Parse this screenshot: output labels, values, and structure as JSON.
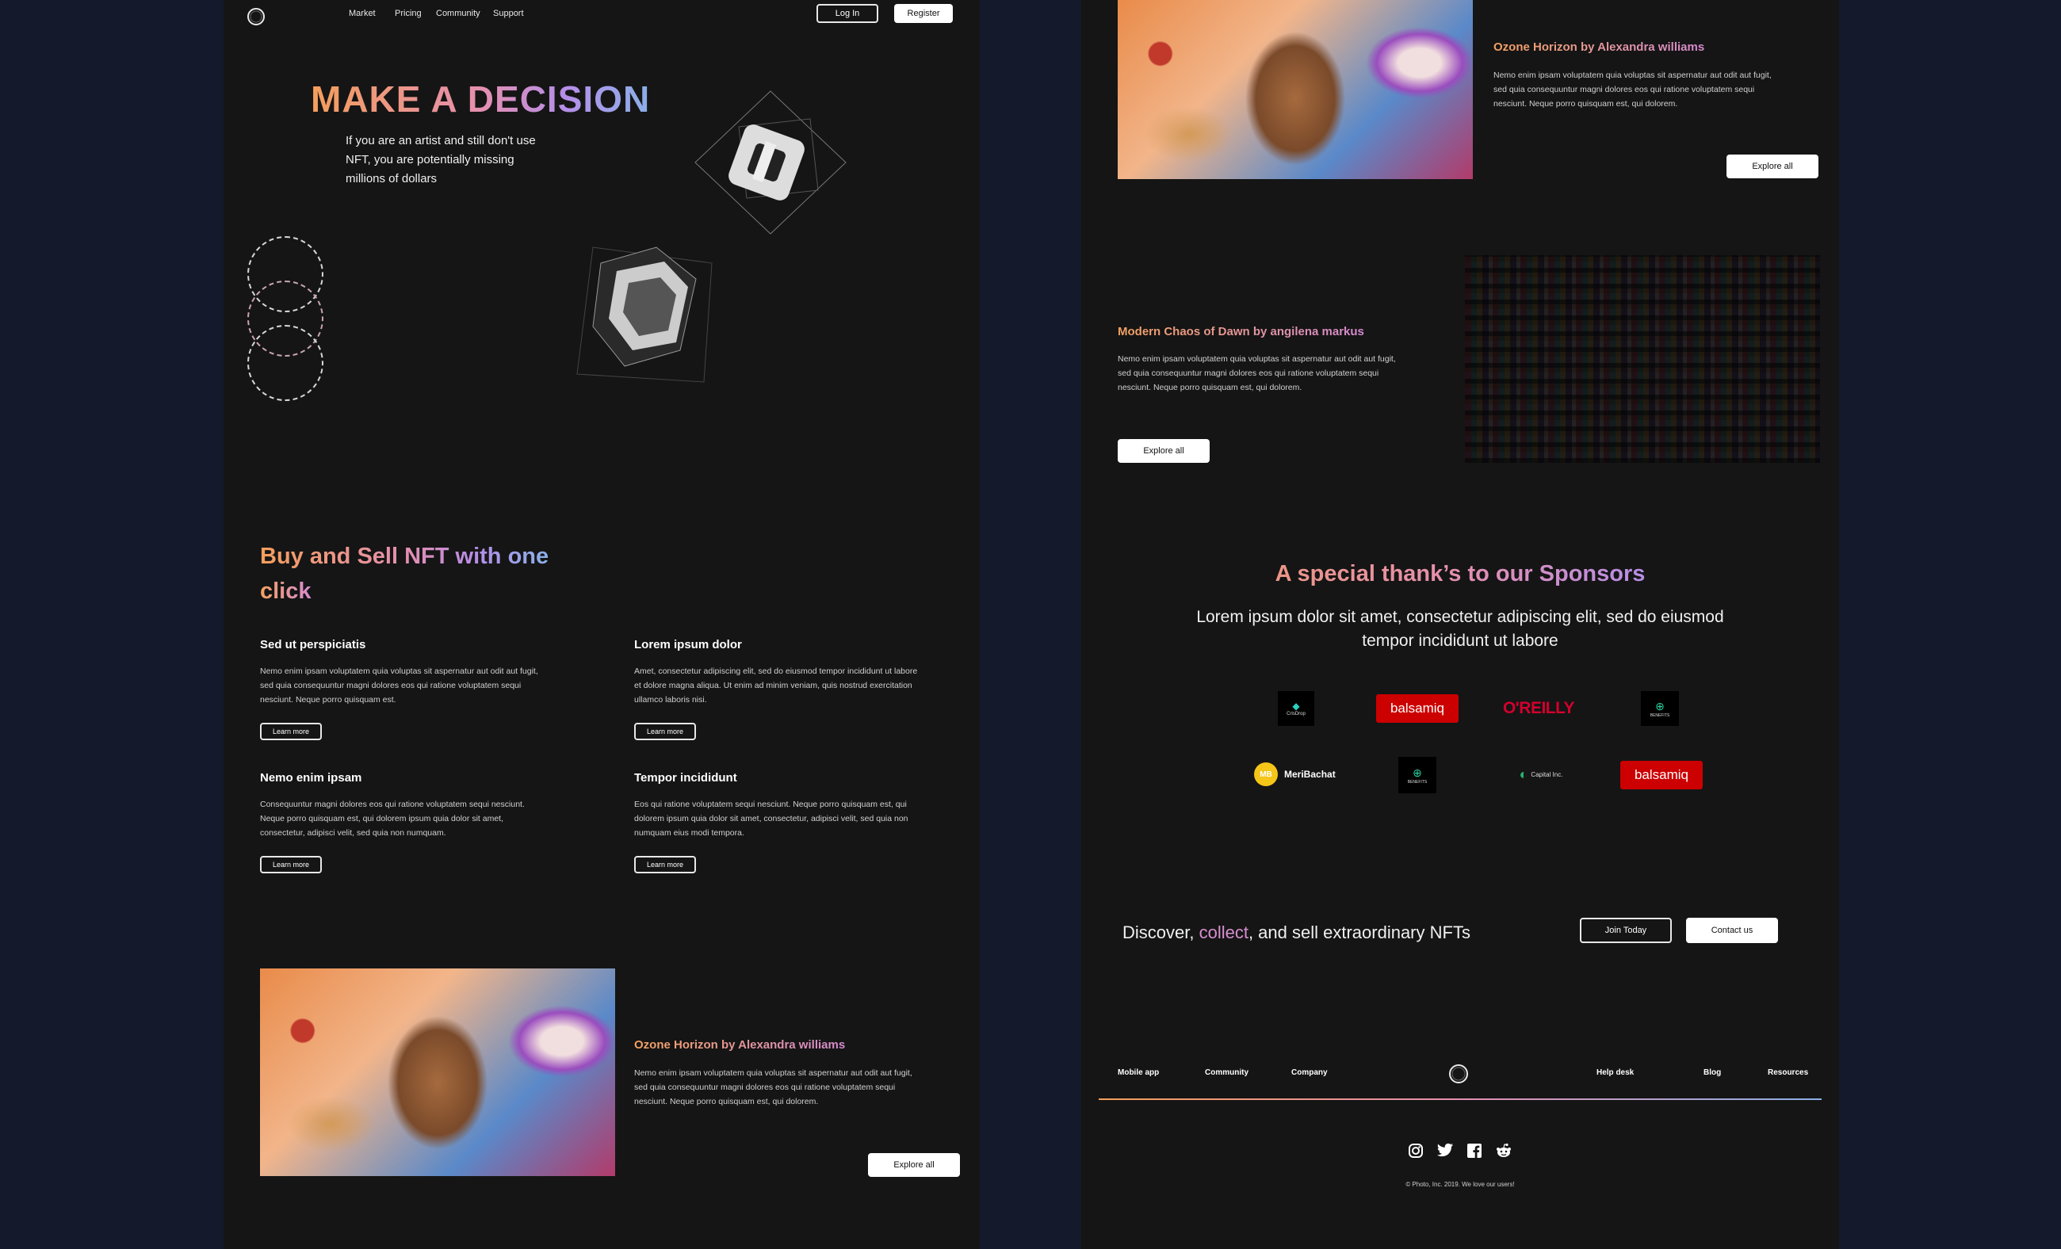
{
  "nav": {
    "links": [
      "Market",
      "Pricing",
      "Community",
      "Support"
    ],
    "login_label": "Log In",
    "register_label": "Register"
  },
  "hero": {
    "title": "MAKE A DECISION",
    "subtitle_lines": [
      "If you are an artist and still don't use",
      "NFT, you are potentially missing",
      "millions of dollars"
    ]
  },
  "buy_sell": {
    "title_line1": "Buy and Sell NFT with one",
    "title_line2": "click",
    "features": [
      {
        "title": "Sed ut perspiciatis",
        "lines": [
          "Nemo enim ipsam voluptatem quia voluptas sit aspernatur aut odit aut fugit,",
          "sed quia consequuntur magni dolores eos qui ratione voluptatem sequi",
          "nesciunt. Neque porro quisquam est."
        ],
        "button": "Learn more"
      },
      {
        "title": "Lorem ipsum dolor",
        "lines": [
          "Amet, consectetur adipiscing elit, sed do eiusmod tempor incididunt ut labore",
          "et dolore magna aliqua. Ut enim ad minim veniam, quis nostrud exercitation",
          "ullamco laboris nisi."
        ],
        "button": "Learn more"
      },
      {
        "title": "Nemo enim ipsam",
        "lines": [
          "Consequuntur magni dolores eos qui ratione voluptatem sequi nesciunt.",
          "Neque porro quisquam est, qui dolorem ipsum quia dolor sit amet,",
          "consectetur, adipisci velit, sed quia non numquam."
        ],
        "button": "Learn more"
      },
      {
        "title": "Tempor incididunt",
        "lines": [
          "Eos qui ratione voluptatem sequi nesciunt. Neque porro quisquam est, qui",
          "dolorem ipsum quia dolor sit amet, consectetur, adipisci velit, sed quia non",
          "numquam eius modi tempora."
        ],
        "button": "Learn more"
      }
    ]
  },
  "artwork_left": {
    "title": "Ozone Horizon by Alexandra williams",
    "lines": [
      "Nemo enim ipsam voluptatem quia voluptas sit aspernatur aut odit aut fugit,",
      "sed quia consequuntur magni dolores eos qui ratione voluptatem sequi",
      "nesciunt. Neque porro quisquam est, qui dolorem."
    ],
    "button": "Explore all"
  },
  "artwork_right_top": {
    "title": "Ozone Horizon by Alexandra williams",
    "lines": [
      "Nemo enim ipsam voluptatem quia voluptas sit aspernatur aut odit aut fugit,",
      "sed quia consequuntur magni dolores eos qui ratione voluptatem sequi",
      "nesciunt. Neque porro quisquam est, qui dolorem."
    ],
    "button": "Explore all"
  },
  "artwork_right_mid": {
    "title": "Modern Chaos of Dawn by angilena markus",
    "lines": [
      "Nemo enim ipsam voluptatem quia voluptas sit aspernatur aut odit aut fugit,",
      "sed quia consequuntur magni dolores eos qui ratione voluptatem sequi",
      "nesciunt. Neque porro quisquam est, qui dolorem."
    ],
    "button": "Explore all"
  },
  "sponsors": {
    "title": "A special thank’s to our Sponsors",
    "subtitle_lines": [
      "Lorem ipsum dolor sit amet, consectetur adipiscing elit, sed do eiusmod",
      "tempor incididunt ut labore"
    ],
    "logos": [
      "CrisDrop",
      "balsamiq",
      "O'REILLY",
      "BENEFITS",
      "MeriBachat",
      "BENEFITS",
      "Capital Inc.",
      "balsamiq"
    ]
  },
  "cta": {
    "text_before": "Discover, ",
    "text_highlight": "collect",
    "text_after": ", and sell extraordinary NFTs",
    "join_label": "Join Today",
    "contact_label": "Contact us"
  },
  "footer": {
    "left_links": [
      "Mobile app",
      "Community",
      "Company"
    ],
    "right_links": [
      "Help desk",
      "Blog",
      "Resources"
    ],
    "social_icons": [
      "instagram-icon",
      "twitter-icon",
      "facebook-icon",
      "reddit-icon"
    ],
    "copyright": "© Photo, Inc. 2019. We love our users!"
  },
  "colors": {
    "page_bg": "#141a2b",
    "panel_bg": "#151515",
    "accent_orange": "#f59e5b",
    "accent_pink": "#e58fb0",
    "accent_purple": "#b58ee8",
    "accent_blue": "#8ab0e8",
    "balsamiq_red": "#cc0000",
    "oreilly_red": "#d3002d"
  }
}
